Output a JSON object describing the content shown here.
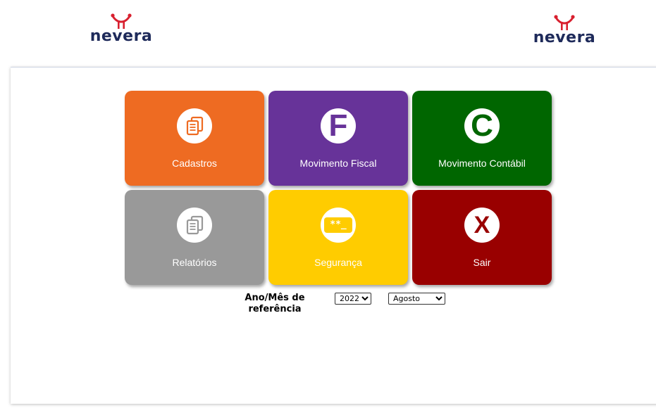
{
  "header": {
    "logo_left_text": "nevera",
    "logo_right_text": "nevera",
    "brand_colors": {
      "mark": "#d8202f",
      "text": "#1e2a5a"
    }
  },
  "menu": {
    "tiles": [
      {
        "label": "Cadastros",
        "icon": "documents-icon",
        "color": "#ee6b22"
      },
      {
        "label": "Movimento Fiscal",
        "icon": "letter-f-icon",
        "icon_text": "F",
        "color": "#673399"
      },
      {
        "label": "Movimento Contábil",
        "icon": "letter-c-icon",
        "icon_text": "C",
        "color": "#006600"
      },
      {
        "label": "Relatórios",
        "icon": "documents-icon",
        "color": "#999999"
      },
      {
        "label": "Segurança",
        "icon": "password-icon",
        "icon_text": "**_",
        "color": "#ffcc00"
      },
      {
        "label": "Sair",
        "icon": "close-icon",
        "icon_text": "X",
        "color": "#990000"
      }
    ]
  },
  "reference": {
    "label": "Ano/Mês de referência",
    "year": "2022",
    "month": "Agosto"
  }
}
